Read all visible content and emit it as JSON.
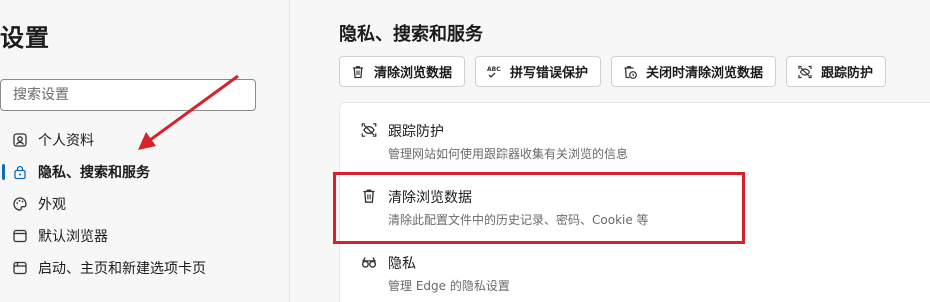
{
  "sidebar": {
    "title": "设置",
    "search_placeholder": "搜索设置",
    "items": [
      {
        "label": "个人资料",
        "icon": "profile-icon"
      },
      {
        "label": "隐私、搜索和服务",
        "icon": "lock-icon",
        "active": true
      },
      {
        "label": "外观",
        "icon": "palette-icon"
      },
      {
        "label": "默认浏览器",
        "icon": "browser-window-icon"
      },
      {
        "label": "启动、主页和新建选项卡页",
        "icon": "tab-page-icon"
      }
    ]
  },
  "main": {
    "section_title": "隐私、搜索和服务",
    "chips": [
      {
        "label": "清除浏览数据",
        "icon": "trash-icon"
      },
      {
        "label": "拼写错误保护",
        "icon": "abc-spellcheck-icon"
      },
      {
        "label": "关闭时清除浏览数据",
        "icon": "trash-clock-icon"
      },
      {
        "label": "跟踪防护",
        "icon": "tracking-prevention-icon"
      }
    ],
    "rows": [
      {
        "title": "跟踪防护",
        "desc": "管理网站如何使用跟踪器收集有关浏览的信息",
        "icon": "tracking-prevention-icon"
      },
      {
        "title": "清除浏览数据",
        "desc": "清除此配置文件中的历史记录、密码、Cookie 等",
        "icon": "trash-icon",
        "highlighted": true
      },
      {
        "title": "隐私",
        "desc": "管理 Edge 的隐私设置",
        "icon": "glasses-icon"
      }
    ]
  },
  "annotation": {
    "color": "#d6222c"
  },
  "colors": {
    "accent": "#0f6cbd"
  }
}
